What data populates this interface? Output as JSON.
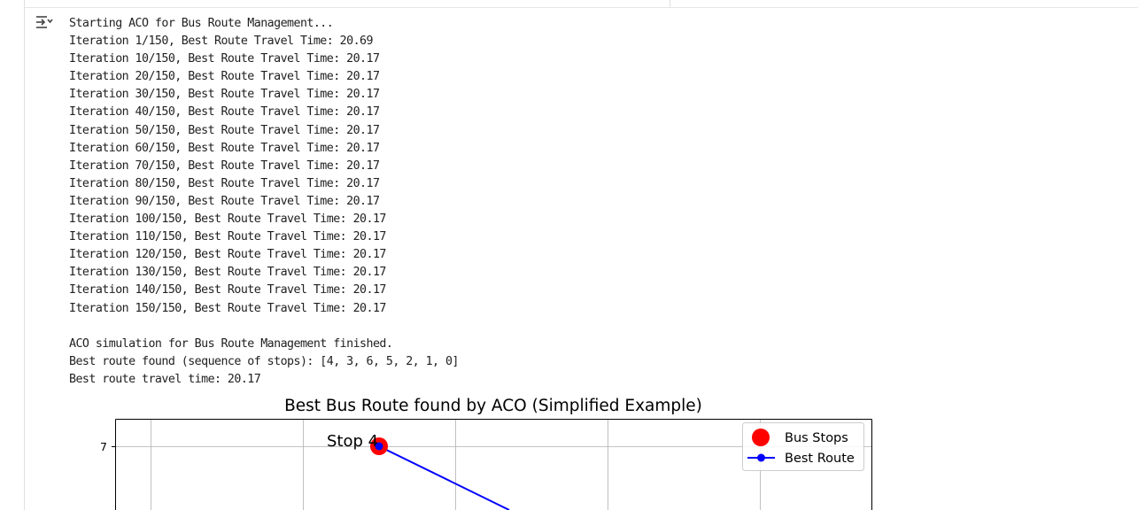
{
  "output": {
    "lines": [
      "Starting ACO for Bus Route Management...",
      "Iteration 1/150, Best Route Travel Time: 20.69",
      "Iteration 10/150, Best Route Travel Time: 20.17",
      "Iteration 20/150, Best Route Travel Time: 20.17",
      "Iteration 30/150, Best Route Travel Time: 20.17",
      "Iteration 40/150, Best Route Travel Time: 20.17",
      "Iteration 50/150, Best Route Travel Time: 20.17",
      "Iteration 60/150, Best Route Travel Time: 20.17",
      "Iteration 70/150, Best Route Travel Time: 20.17",
      "Iteration 80/150, Best Route Travel Time: 20.17",
      "Iteration 90/150, Best Route Travel Time: 20.17",
      "Iteration 100/150, Best Route Travel Time: 20.17",
      "Iteration 110/150, Best Route Travel Time: 20.17",
      "Iteration 120/150, Best Route Travel Time: 20.17",
      "Iteration 130/150, Best Route Travel Time: 20.17",
      "Iteration 140/150, Best Route Travel Time: 20.17",
      "Iteration 150/150, Best Route Travel Time: 20.17",
      "",
      "ACO simulation for Bus Route Management finished.",
      "Best route found (sequence of stops): [4, 3, 6, 5, 2, 1, 0]",
      "Best route travel time: 20.17"
    ]
  },
  "icons": {
    "output_toggle": "output-collapse-icon"
  },
  "colors": {
    "stops": "#ff0000",
    "route": "#0000ff",
    "route_marker": "#0000ff"
  },
  "chart_data": {
    "type": "scatter",
    "title": "Best Bus Route found by ACO (Simplified Example)",
    "xlabel": "",
    "ylabel": "",
    "yticks": [
      7
    ],
    "ytick_labels": [
      "7"
    ],
    "grid": true,
    "legend_position": "top-right",
    "legend": [
      "Bus Stops",
      "Best Route"
    ],
    "series": [
      {
        "name": "Bus Stops",
        "points": [
          {
            "y": 7,
            "label": "Stop 4"
          }
        ]
      },
      {
        "name": "Best Route",
        "points": [
          {
            "y": 7
          }
        ]
      }
    ],
    "annotations": [
      "Stop 4"
    ]
  }
}
